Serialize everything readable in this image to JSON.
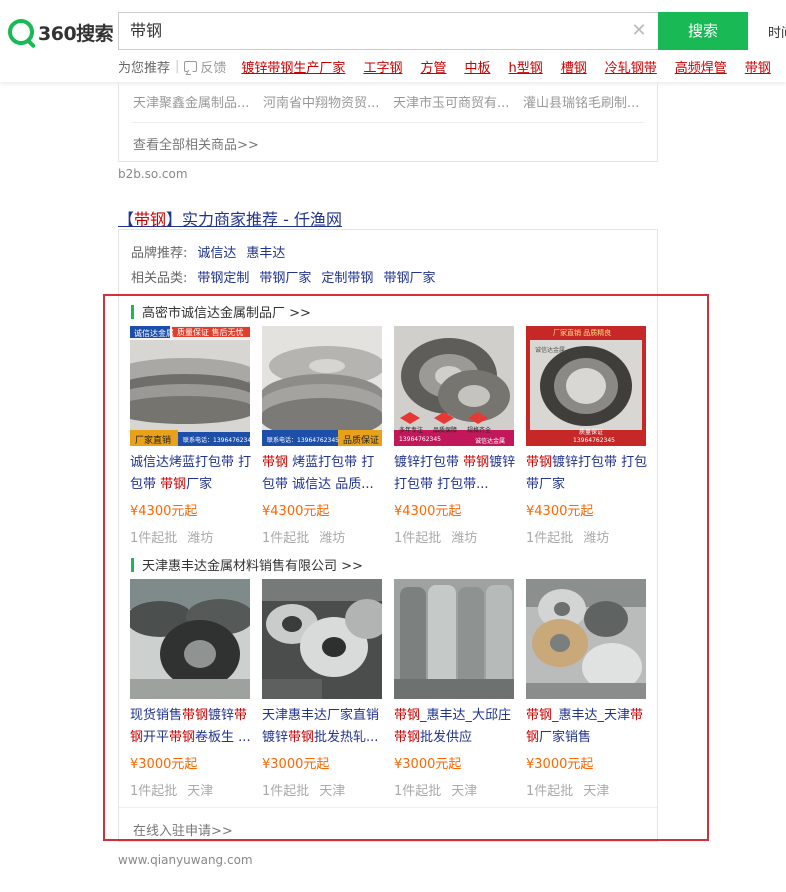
{
  "header": {
    "logo_text": "360搜索",
    "search_value": "带钢",
    "search_button": "搜索",
    "time_link": "时间",
    "rec_label": "为您推荐",
    "feedback_label": "反馈",
    "rec_links": [
      "镀锌带钢生产厂家",
      "工字钢",
      "方管",
      "中板",
      "h型钢",
      "槽钢",
      "冷轧钢带",
      "高频焊管",
      "带钢"
    ]
  },
  "top_card": {
    "shops": [
      "天津聚鑫金属制品...",
      "河南省中翔物资贸...",
      "天津市玉可商贸有...",
      "灌山县瑞铭毛刷制..."
    ],
    "view_all": "查看全部相关商品>>",
    "cite": "b2b.so.com"
  },
  "result": {
    "title_prefix": "【",
    "title_hl": "带钢",
    "title_rest": "】实力商家推荐 - 仟渔网",
    "brand_label": "品牌推荐:",
    "brands": [
      "诚信达",
      "惠丰达"
    ],
    "category_label": "相关品类:",
    "categories": [
      "带钢定制",
      "带钢厂家",
      "定制带钢",
      "带钢厂家"
    ],
    "stores": [
      {
        "name": "高密市诚信达金属制品厂 >>",
        "products": [
          {
            "name_parts": [
              [
                "诚信达烤蓝打包带 打包带 ",
                false
              ],
              [
                "带钢",
                true
              ],
              [
                "厂家",
                false
              ]
            ],
            "price": "¥4300元起",
            "min": "1件起批",
            "loc": "潍坊"
          },
          {
            "name_parts": [
              [
                "带钢",
                true
              ],
              [
                " 烤蓝打包带 打包带 诚信达 品质...",
                false
              ]
            ],
            "price": "¥4300元起",
            "min": "1件起批",
            "loc": "潍坊"
          },
          {
            "name_parts": [
              [
                "镀锌打包带 ",
                false
              ],
              [
                "带钢",
                true
              ],
              [
                "镀锌打包带 打包带...",
                false
              ]
            ],
            "price": "¥4300元起",
            "min": "1件起批",
            "loc": "潍坊"
          },
          {
            "name_parts": [
              [
                "带钢",
                true
              ],
              [
                "镀锌打包带 打包带厂家",
                false
              ]
            ],
            "price": "¥4300元起",
            "min": "1件起批",
            "loc": "潍坊"
          }
        ]
      },
      {
        "name": "天津惠丰达金属材料销售有限公司 >>",
        "products": [
          {
            "name_parts": [
              [
                "现货销售",
                false
              ],
              [
                "带钢",
                true
              ],
              [
                "镀锌",
                false
              ],
              [
                "带钢",
                true
              ],
              [
                "开平",
                false
              ],
              [
                "带钢",
                true
              ],
              [
                "卷板生 ...",
                false
              ]
            ],
            "price": "¥3000元起",
            "min": "1件起批",
            "loc": "天津"
          },
          {
            "name_parts": [
              [
                "天津惠丰达厂家直销镀锌",
                false
              ],
              [
                "带钢",
                true
              ],
              [
                "批发热轧...",
                false
              ]
            ],
            "price": "¥3000元起",
            "min": "1件起批",
            "loc": "天津"
          },
          {
            "name_parts": [
              [
                "带钢",
                true
              ],
              [
                "_惠丰达_大邱庄",
                false
              ],
              [
                "带钢",
                true
              ],
              [
                "批发供应",
                false
              ]
            ],
            "price": "¥3000元起",
            "min": "1件起批",
            "loc": "天津"
          },
          {
            "name_parts": [
              [
                "带钢",
                true
              ],
              [
                "_惠丰达_天津",
                false
              ],
              [
                "带钢",
                true
              ],
              [
                "厂家销售",
                false
              ]
            ],
            "price": "¥3000元起",
            "min": "1件起批",
            "loc": "天津"
          }
        ]
      }
    ],
    "apply": "在线入驻申请>>",
    "cite": "www.qianyuwang.com"
  },
  "image_tags": {
    "p1_top": "诚信达金属",
    "p1_top2": "质量保证 售后无忧",
    "p1_bottom": "厂家直销",
    "p1_phone": "联系电话：13964762345",
    "p2_phone": "联系电话：13964762345",
    "p2_badge": "品质保证",
    "p3_badge1": "多年专注",
    "p3_badge2": "品质保障",
    "p3_badge3": "规格齐全",
    "p3_phone": "13964762345",
    "p3_brand": "诚信达金属",
    "p4_top": "厂家直销 品质精良",
    "p4_brand": "诚信达金属",
    "p4_quality": "质量保证",
    "p4_phone": "13964762345"
  },
  "colors": {
    "accent": "#19b955",
    "link": "#20338e",
    "highlight": "#c00",
    "price": "#f60",
    "box": "#d32f3c"
  }
}
